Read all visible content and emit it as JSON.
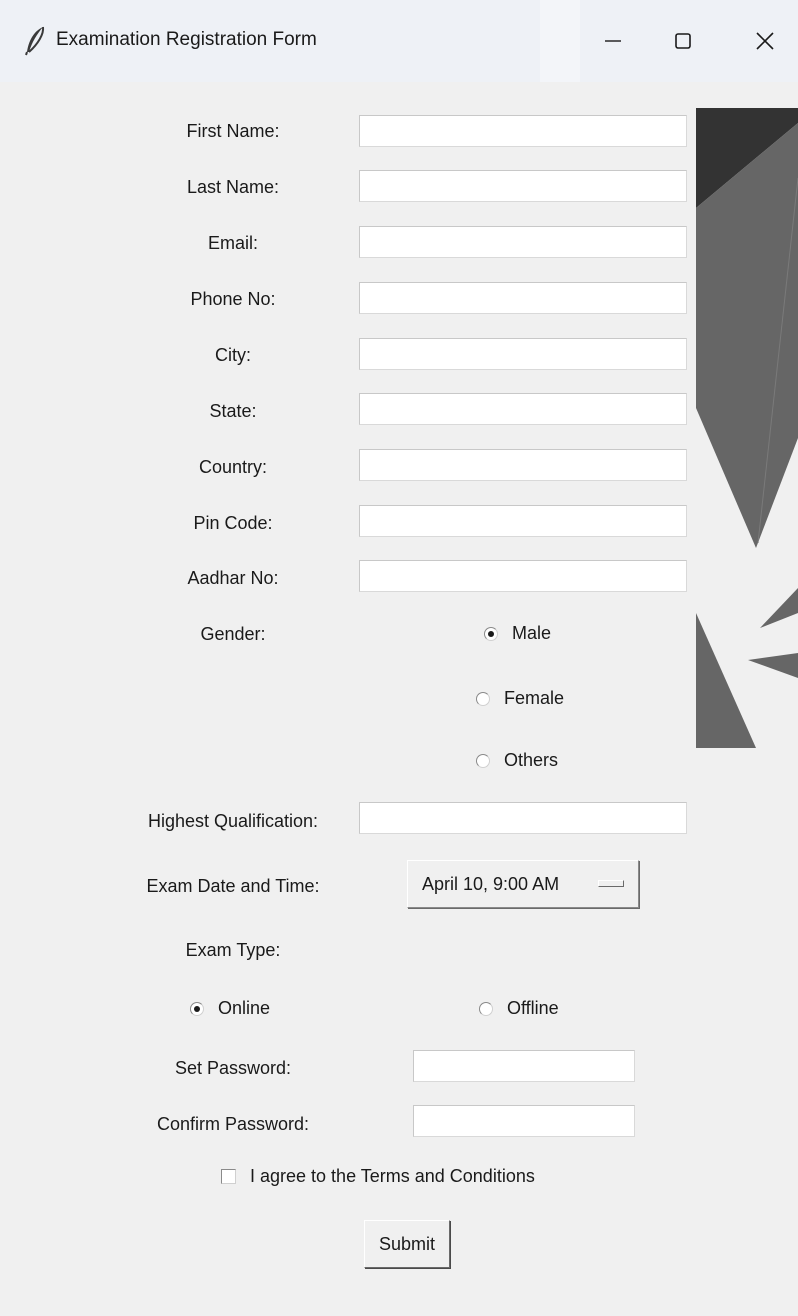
{
  "window": {
    "title": "Examination Registration Form",
    "minimize_glyph": "—",
    "maximize_glyph": "☐",
    "close_glyph": "✕"
  },
  "form": {
    "first_name": {
      "label": "First Name:",
      "value": ""
    },
    "last_name": {
      "label": "Last Name:",
      "value": ""
    },
    "email": {
      "label": "Email:",
      "value": ""
    },
    "phone": {
      "label": "Phone No:",
      "value": ""
    },
    "city": {
      "label": "City:",
      "value": ""
    },
    "state": {
      "label": "State:",
      "value": ""
    },
    "country": {
      "label": "Country:",
      "value": ""
    },
    "pin_code": {
      "label": "Pin Code:",
      "value": ""
    },
    "aadhar": {
      "label": "Aadhar No:",
      "value": ""
    },
    "gender": {
      "label": "Gender:",
      "options": [
        "Male",
        "Female",
        "Others"
      ],
      "selected": "Male"
    },
    "qualification": {
      "label": "Highest Qualification:",
      "value": ""
    },
    "exam_datetime": {
      "label": "Exam Date and Time:",
      "selected": "April 10, 9:00 AM"
    },
    "exam_type": {
      "label": "Exam Type:",
      "options": [
        "Online",
        "Offline"
      ],
      "selected": "Online"
    },
    "password": {
      "label": "Set Password:",
      "value": ""
    },
    "confirm_password": {
      "label": "Confirm Password:",
      "value": ""
    },
    "terms": {
      "label": "I agree to the Terms and Conditions",
      "checked": false
    },
    "submit_label": "Submit"
  },
  "colors": {
    "background": "#f0f0f0",
    "titlebar": "#eef1f6",
    "decor_dark": "#333333",
    "decor_mid": "#666666"
  },
  "icons": {
    "app": "feather-icon",
    "minimize": "minimize-icon",
    "maximize": "maximize-icon",
    "close": "close-icon"
  }
}
